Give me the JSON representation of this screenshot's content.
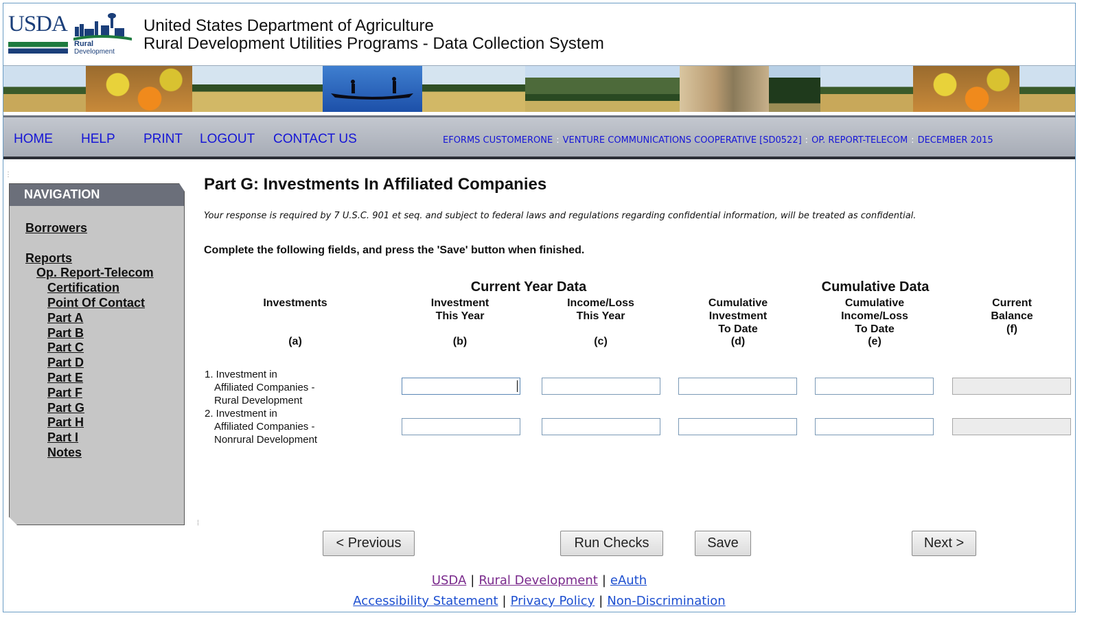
{
  "header": {
    "logo_usda": "USDA",
    "logo_rural": "Rural",
    "logo_development": "Development",
    "title_line1": "United States Department of Agriculture",
    "title_line2": "Rural Development Utilities Programs - Data Collection System"
  },
  "nav": {
    "items": [
      "HOME",
      "HELP",
      "PRINT",
      "LOGOUT",
      "CONTACT US"
    ],
    "context": {
      "user": "EFORMS CUSTOMERONE",
      "borrower": "VENTURE COMMUNICATIONS COOPERATIVE [SD0522]",
      "report": "OP. REPORT-TELECOM",
      "period": "DECEMBER 2015",
      "separator": ":"
    },
    "link_color": "#1515d6"
  },
  "sidebar": {
    "heading": "NAVIGATION",
    "borrowers": "Borrowers",
    "reports": "Reports",
    "report_name": "Op. Report-Telecom",
    "items": [
      "Certification",
      "Point Of Contact",
      "Part A",
      "Part B",
      "Part C",
      "Part D",
      "Part E",
      "Part F",
      "Part G",
      "Part H",
      "Part I",
      "Notes"
    ]
  },
  "page": {
    "title": "Part G: Investments In Affiliated Companies",
    "notice": "Your response is required by 7 U.S.C. 901 et seq. and subject to federal laws and regulations regarding confidential information, will be treated as confidential.",
    "instructions": "Complete the following fields, and press the 'Save' button when finished."
  },
  "table": {
    "group_current": "Current Year Data",
    "group_cumulative": "Cumulative Data",
    "columns": [
      {
        "lines": [
          "Investments"
        ],
        "letter": "(a)"
      },
      {
        "lines": [
          "Investment",
          "This Year"
        ],
        "letter": "(b)"
      },
      {
        "lines": [
          "Income/Loss",
          "This Year"
        ],
        "letter": "(c)"
      },
      {
        "lines": [
          "Cumulative",
          "Investment",
          "To Date"
        ],
        "letter": "(d)"
      },
      {
        "lines": [
          "Cumulative",
          "Income/Loss",
          "To Date"
        ],
        "letter": "(e)"
      },
      {
        "lines": [
          "Current",
          "Balance"
        ],
        "letter": "(f)"
      }
    ],
    "rows": [
      {
        "label_lines": [
          "1. Investment in",
          "Affiliated Companies -",
          "Rural Development"
        ],
        "values": [
          "",
          "",
          "",
          "",
          ""
        ]
      },
      {
        "label_lines": [
          "2. Investment in",
          "Affiliated Companies -",
          "Nonrural Development"
        ],
        "values": [
          "",
          "",
          "",
          "",
          ""
        ]
      }
    ]
  },
  "buttons": {
    "previous": "< Previous",
    "run_checks": "Run Checks",
    "save": "Save",
    "next": "Next >"
  },
  "footer": {
    "row1": [
      "USDA",
      "Rural Development",
      "eAuth"
    ],
    "row2": [
      "Accessibility Statement",
      "Privacy Policy",
      "Non-Discrimination"
    ],
    "pipe": "|"
  }
}
